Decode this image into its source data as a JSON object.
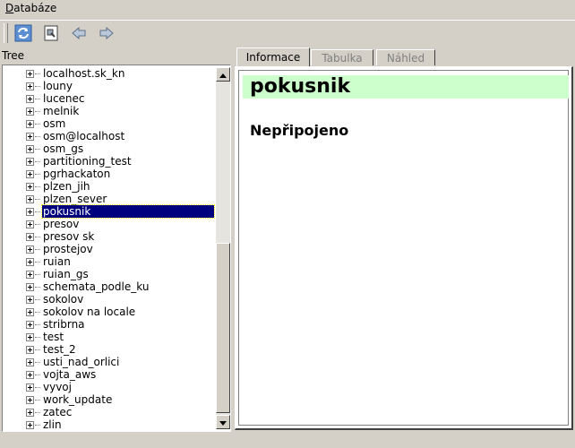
{
  "menu": {
    "database_label": "Databáze"
  },
  "toolbar": {
    "refresh_icon": "refresh-icon",
    "document_icon": "document-icon",
    "back_icon": "back-arrow-icon",
    "forward_icon": "forward-arrow-icon"
  },
  "tree": {
    "header": "Tree",
    "items": [
      "localhost.sk_kn",
      "louny",
      "lucenec",
      "melnik",
      "osm",
      "osm@localhost",
      "osm_gs",
      "partitioning_test",
      "pgrhackaton",
      "plzen_jih",
      "plzen_sever",
      "pokusnik",
      "presov",
      "presov sk",
      "prostejov",
      "ruian",
      "ruian_gs",
      "schemata_podle_ku",
      "sokolov",
      "sokolov na locale",
      "stribrna",
      "test",
      "test_2",
      "usti_nad_orlici",
      "vojta_aws",
      "vyvoj",
      "work_update",
      "zatec",
      "zlin"
    ],
    "selected": "pokusnik"
  },
  "tabs": [
    {
      "label": "Informace",
      "state": "active"
    },
    {
      "label": "Tabulka",
      "state": "disabled"
    },
    {
      "label": "Náhled",
      "state": "disabled"
    }
  ],
  "content": {
    "title": "pokusnik",
    "status": "Nepřipojeno"
  },
  "colors": {
    "title_background": "#ccffcc",
    "selection_background": "#00007f",
    "window_background": "#d4d0c8"
  }
}
